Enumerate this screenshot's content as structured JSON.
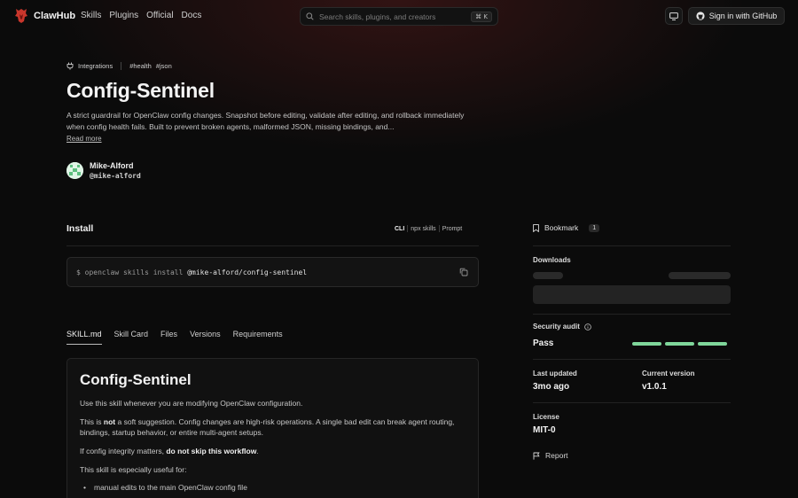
{
  "nav": {
    "brand": "ClawHub",
    "links": [
      "Skills",
      "Plugins",
      "Official",
      "Docs"
    ],
    "search_placeholder": "Search skills, plugins, and creators",
    "search_shortcut": "⌘ K",
    "signin_label": "Sign in with GitHub"
  },
  "header": {
    "category": "Integrations",
    "tags": [
      "#health",
      "#json"
    ],
    "title": "Config-Sentinel",
    "description": "A strict guardrail for OpenClaw config changes. Snapshot before editing, validate after editing, and rollback immediately when config health fails. Built to prevent broken agents, malformed JSON, missing bindings, and...",
    "read_more": "Read more",
    "author_name": "Mike-Alford",
    "author_handle": "@mike-alford"
  },
  "install": {
    "title": "Install",
    "tabs": [
      "CLI",
      "npx skills",
      "Prompt"
    ],
    "command_prefix": "$ openclaw skills install ",
    "command_target": "@mike-alford/config-sentinel"
  },
  "doc_tabs": [
    "SKILL.md",
    "Skill Card",
    "Files",
    "Versions",
    "Requirements"
  ],
  "skill_doc": {
    "heading": "Config-Sentinel",
    "p1": "Use this skill whenever you are modifying OpenClaw configuration.",
    "p2_a": "This is ",
    "p2_b": "not",
    "p2_c": " a soft suggestion. Config changes are high-risk operations. A single bad edit can break agent routing, bindings, startup behavior, or entire multi-agent setups.",
    "p3_a": "If config integrity matters, ",
    "p3_b": "do not skip this workflow",
    "p3_c": ".",
    "p4": "This skill is especially useful for:",
    "li1": "manual edits to the main OpenClaw config file"
  },
  "sidebar": {
    "bookmark_label": "Bookmark",
    "bookmark_count": "1",
    "downloads_label": "Downloads",
    "security_label": "Security audit",
    "security_value": "Pass",
    "last_updated_label": "Last updated",
    "last_updated_value": "3mo ago",
    "version_label": "Current version",
    "version_value": "v1.0.1",
    "license_label": "License",
    "license_value": "MIT-0",
    "report_label": "Report"
  }
}
